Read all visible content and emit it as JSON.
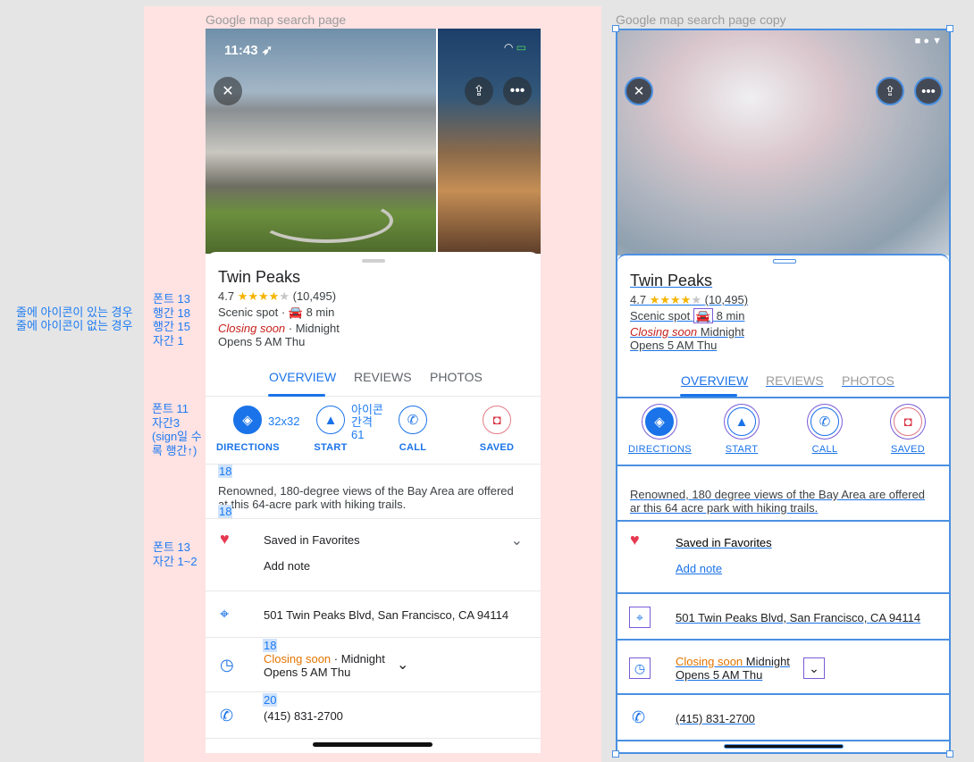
{
  "annotations": {
    "left_notes": [
      "줄에 아이콘이 있는 경우",
      "줄에 아이콘이 없는 경우"
    ],
    "spec_text": [
      "폰트 13",
      "행간 18",
      "행간 15",
      "자간 1"
    ],
    "spec_buttons": [
      "폰트 11",
      "자간3",
      "(sign일 수",
      "록 행간↑)"
    ],
    "spec_row": [
      "폰트 13",
      "자간 1~2"
    ],
    "icon_size": "32x32",
    "icon_gap": [
      "아이콘",
      "간격",
      "61"
    ],
    "hl_18a": "18",
    "hl_18b": "18",
    "hl_18c": "18",
    "hl_20": "20"
  },
  "frames": {
    "a_title": "Google map search page",
    "b_title": "Google map search page copy"
  },
  "status": {
    "time": "11:43"
  },
  "place": {
    "name": "Twin Peaks",
    "rating": "4.7",
    "reviews": "(10,495)",
    "category": "Scenic spot",
    "drive": "8 min",
    "closing": "Closing soon",
    "closing_time": "Midnight",
    "opens": "Opens 5 AM Thu"
  },
  "tabs": [
    "OVERVIEW",
    "REVIEWS",
    "PHOTOS"
  ],
  "actions": [
    "DIRECTIONS",
    "START",
    "CALL",
    "SAVED"
  ],
  "description": "Renowned, 180-degree views of the Bay Area are offered at this 64-acre park with hiking trails.",
  "description_b": "Renowned, 180  degree views of the Bay Area are offered ar this 64  acre park with hiking trails.",
  "saved": {
    "label": "Saved in Favorites",
    "add_note": "Add note"
  },
  "address": "501 Twin Peaks Blvd, San Francisco, CA 94114",
  "phone": "(415) 831-2700",
  "colors": {
    "accent": "#1a73e8",
    "annotation": "#1d7bf2",
    "closing_red": "#c5221f",
    "closing_orange": "#e37400"
  }
}
